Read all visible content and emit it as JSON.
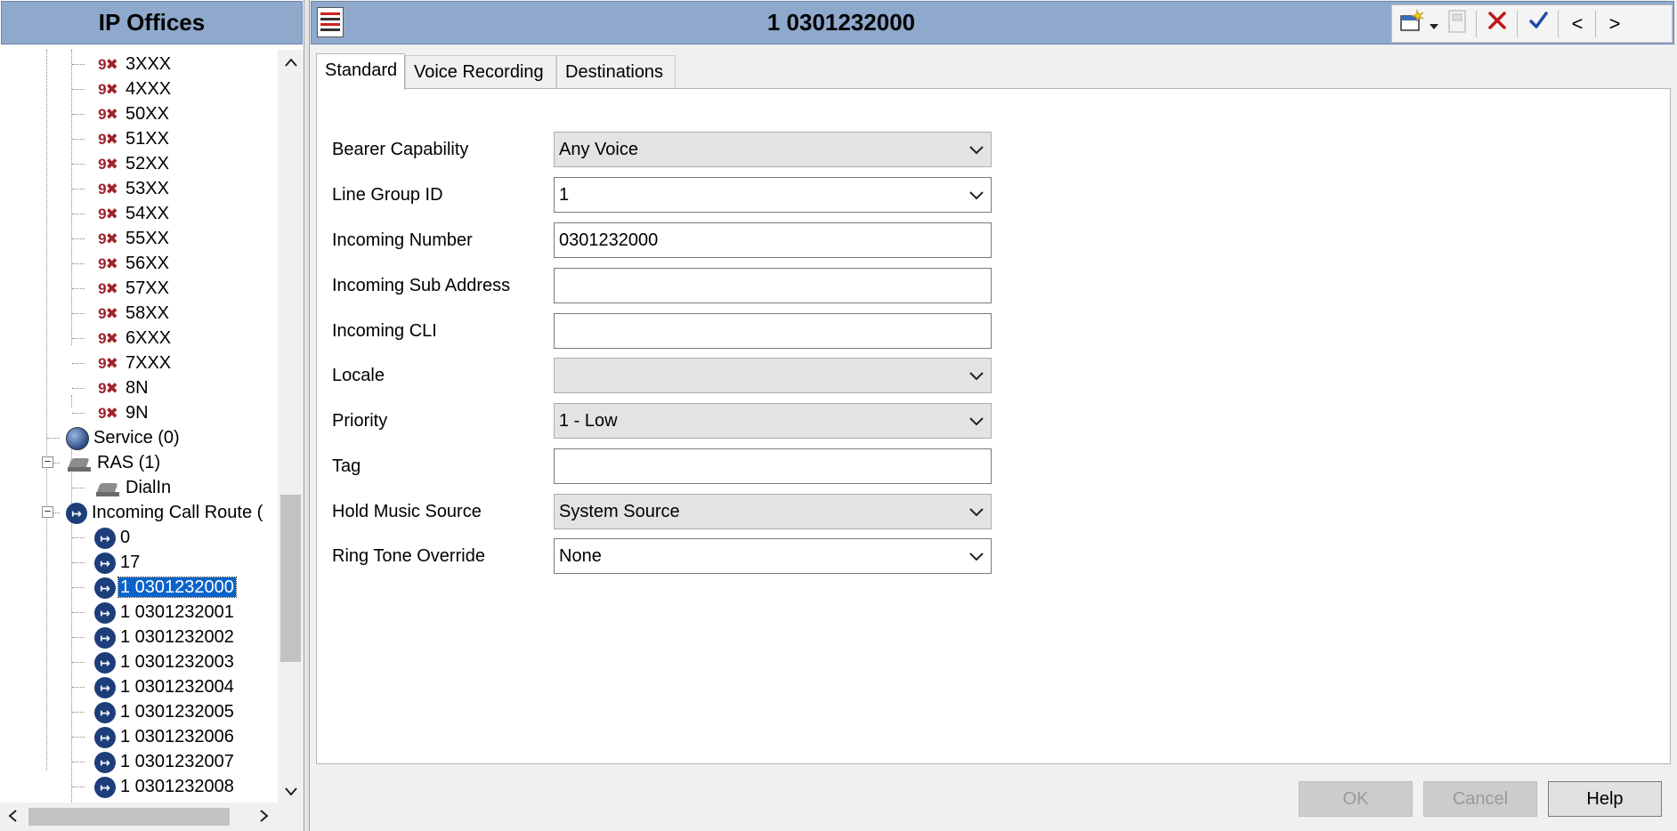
{
  "left": {
    "header": "IP Offices",
    "tree": {
      "short_codes": [
        "3XXX",
        "4XXX",
        "50XX",
        "51XX",
        "52XX",
        "53XX",
        "54XX",
        "55XX",
        "56XX",
        "57XX",
        "58XX",
        "6XXX",
        "7XXX",
        "8N",
        "9N"
      ],
      "short_code_icon_text": "9✖",
      "service": "Service (0)",
      "ras": "RAS (1)",
      "ras_child": "DialIn",
      "icr": "Incoming Call Route (",
      "icr_items": [
        "0",
        "17",
        "1 0301232000",
        "1 0301232001",
        "1 0301232002",
        "1 0301232003",
        "1 0301232004",
        "1 0301232005",
        "1 0301232006",
        "1 0301232007",
        "1 0301232008"
      ],
      "selected_item": "1 0301232000"
    }
  },
  "right": {
    "title": "1 0301232000",
    "toolbar": {
      "new_icon": "new-item-icon",
      "dropdown_icon": "caret-down-icon",
      "export_icon": "export-icon",
      "delete_icon": "delete-x-icon",
      "validate_icon": "checkmark-icon",
      "prev_label": "<",
      "next_label": ">"
    },
    "tabs": [
      "Standard",
      "Voice Recording",
      "Destinations"
    ],
    "active_tab": "Standard",
    "form": {
      "bearer_capability": {
        "label": "Bearer Capability",
        "value": "Any Voice"
      },
      "line_group_id": {
        "label": "Line Group ID",
        "value": "1"
      },
      "incoming_number": {
        "label": "Incoming Number",
        "value": "0301232000"
      },
      "incoming_sub_address": {
        "label": "Incoming Sub Address",
        "value": ""
      },
      "incoming_cli": {
        "label": "Incoming CLI",
        "value": ""
      },
      "locale": {
        "label": "Locale",
        "value": ""
      },
      "priority": {
        "label": "Priority",
        "value": "1 - Low"
      },
      "tag": {
        "label": "Tag",
        "value": ""
      },
      "hold_music_source": {
        "label": "Hold Music Source",
        "value": "System Source"
      },
      "ring_tone_override": {
        "label": "Ring Tone Override",
        "value": "None"
      }
    },
    "buttons": {
      "ok": "OK",
      "cancel": "Cancel",
      "help": "Help"
    }
  },
  "colors": {
    "header_blue": "#8fa9cc",
    "selection_blue": "#0a63c9",
    "short_code_red": "#a0222a",
    "route_icon_navy": "#1d3e7a",
    "delete_red": "#c0151b",
    "check_blue": "#1f4aa8"
  }
}
